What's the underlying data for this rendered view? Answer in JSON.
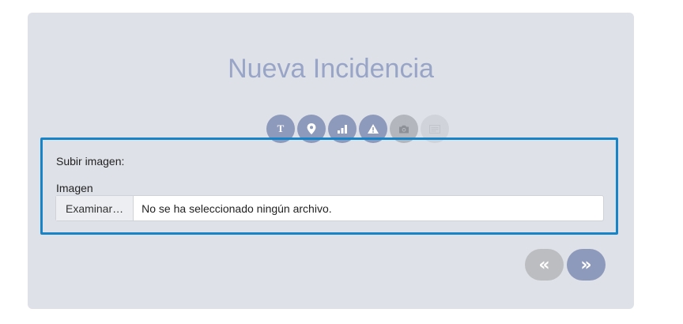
{
  "title": "Nueva Incidencia",
  "steps": [
    {
      "icon": "text-icon",
      "glyph": "T",
      "state": "done"
    },
    {
      "icon": "location-pin-icon",
      "state": "done"
    },
    {
      "icon": "signal-bars-icon",
      "state": "done"
    },
    {
      "icon": "warning-icon",
      "state": "done"
    },
    {
      "icon": "camera-icon",
      "state": "current"
    },
    {
      "icon": "notes-icon",
      "state": "pending"
    }
  ],
  "upload": {
    "heading": "Subir imagen:",
    "field_label": "Imagen",
    "browse_label": "Examinar…",
    "status": "No se ha seleccionado ningún archivo."
  },
  "nav": {
    "prev_label": "«",
    "next_label": "»"
  },
  "colors": {
    "card_bg": "#dfe1e8",
    "title": "#98a5c7",
    "step_done": "#8e9abb",
    "step_current": "#b4b6bd",
    "step_pending": "#d0d3da",
    "panel_border": "#1784c7",
    "nav_prev": "#bcbdc1",
    "nav_next": "#8e9abb"
  }
}
